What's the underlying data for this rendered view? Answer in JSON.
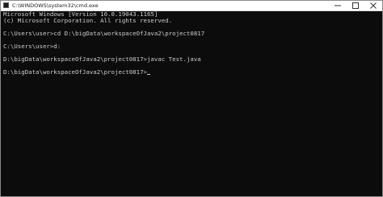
{
  "window": {
    "title": "C:\\WINDOWS\\system32\\cmd.exe",
    "app_icon": "cmd-icon",
    "buttons": {
      "minimize": "minimize-icon",
      "maximize": "maximize-icon",
      "close": "close-icon"
    }
  },
  "console": {
    "lines": [
      "Microsoft Windows [Version 10.0.19043.1165]",
      "(c) Microsoft Corporation. All rights reserved.",
      "",
      "C:\\Users\\user>cd D:\\bigData\\workspaceOfJava2\\project0817",
      "",
      "C:\\Users\\user>d:",
      "",
      "D:\\bigData\\workspaceOfJava2\\project0817>javac Test.java",
      "",
      "D:\\bigData\\workspaceOfJava2\\project0817>"
    ]
  },
  "colors": {
    "console_background": "#0c0c0c",
    "console_text": "#cccccc",
    "titlebar_background": "#ffffff"
  }
}
